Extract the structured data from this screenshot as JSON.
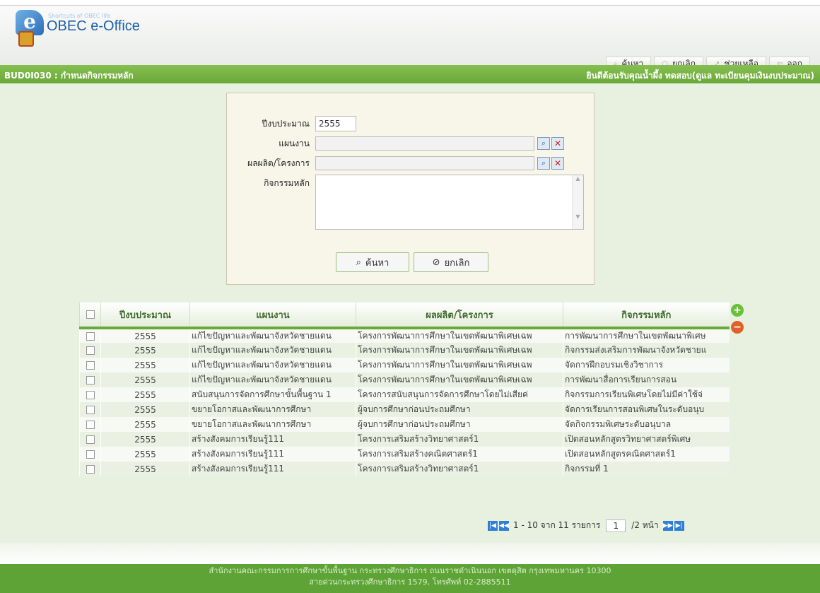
{
  "header": {
    "brand_tag": "Shortcuts of OBEC life",
    "brand_name": "OBEC e-Office",
    "nav": [
      {
        "label": "ค้นหา"
      },
      {
        "label": "ยกเลิก"
      },
      {
        "label": "ช่วยเหลือ"
      },
      {
        "label": "ออก"
      }
    ]
  },
  "title_bar": {
    "screen": "BUD0I030 : กำหนดกิจกรรมหลัก",
    "welcome": "ยินดีต้อนรับคุณน้ำผึ้ง ทดสอบ(ดูแล ทะเบียนคุมเงินงบประมาณ)"
  },
  "form": {
    "year_label": "ปีงบประมาณ",
    "year_value": "2555",
    "plan_label": "แผนงาน",
    "project_label": "ผลผลิต/โครงการ",
    "activity_label": "กิจกรรมหลัก",
    "search_button": "ค้นหา",
    "cancel_button": "ยกเลิก"
  },
  "table": {
    "columns": [
      "ปีงบประมาณ",
      "แผนงาน",
      "ผลผลิต/โครงการ",
      "กิจกรรมหลัก"
    ],
    "rows": [
      [
        "2555",
        "แก้ไขปัญหาและพัฒนาจังหวัดชายแดน",
        "โครงการพัฒนาการศึกษาในเขตพัฒนาพิเศษเฉพ",
        "การพัฒนาการศึกษาในเขตพัฒนาพิเศษ"
      ],
      [
        "2555",
        "แก้ไขปัญหาและพัฒนาจังหวัดชายแดน",
        "โครงการพัฒนาการศึกษาในเขตพัฒนาพิเศษเฉพ",
        "กิจกรรมส่งเสริมการพัฒนาจังหวัดชายแ"
      ],
      [
        "2555",
        "แก้ไขปัญหาและพัฒนาจังหวัดชายแดน",
        "โครงการพัฒนาการศึกษาในเขตพัฒนาพิเศษเฉพ",
        "จัดการฝึกอบรมเชิงวิชาการ"
      ],
      [
        "2555",
        "แก้ไขปัญหาและพัฒนาจังหวัดชายแดน",
        "โครงการพัฒนาการศึกษาในเขตพัฒนาพิเศษเฉพ",
        "การพัฒนาสื่อการเรียนการสอน"
      ],
      [
        "2555",
        "สนับสนุนการจัดการศึกษาขั้นพื้นฐาน 1",
        "โครงการสนับสนุนการจัดการศึกษาโดยไม่เสียค่",
        "กิจกรรมการเรียนพิเศษโดยไม่มีค่าใช้จ่"
      ],
      [
        "2555",
        "ขยายโอกาสและพัฒนาการศึกษา",
        "ผู้จบการศึกษาก่อนประถมศึกษา",
        "จัดการเรียนการสอนพิเศษในระดับอนุบ"
      ],
      [
        "2555",
        "ขยายโอกาสและพัฒนาการศึกษา",
        "ผู้จบการศึกษาก่อนประถมศึกษา",
        "จัดกิจกรรมพิเศษระดับอนุบาล"
      ],
      [
        "2555",
        "สร้างสังคมการเรียนรู้111",
        "โครงการเสริมสร้างวิทยาศาสตร์1",
        "เปิดสอนหลักสูตรวิทยาศาสตร์พิเศษ"
      ],
      [
        "2555",
        "สร้างสังคมการเรียนรู้111",
        "โครงการเสริมสร้างคณิตศาสตร์1",
        "เปิดสอนหลักสูตรคณิตศาสตร์1"
      ],
      [
        "2555",
        "สร้างสังคมการเรียนรู้111",
        "โครงการเสริมสร้างวิทยาศาสตร์1",
        "กิจกรรมที่ 1"
      ]
    ]
  },
  "pager": {
    "range_text": "1 - 10 จาก 11 รายการ",
    "page_value": "1",
    "total_text": "/2 หน้า"
  },
  "footer": {
    "line1": "สำนักงานคณะกรรมการการศึกษาขั้นพื้นฐาน กระทรวงศึกษาธิการ ถนนราชดำเนินนอก เขตดุสิต กรุงเทพมหานคร 10300",
    "line2": "สายด่วนกระทรวงศึกษาธิการ 1579, โทรศัพท์ 02-2885511"
  },
  "colors": {
    "accent_green": "#6aa83a",
    "footer_green": "#5ea335",
    "brand_blue": "#1c5fa8"
  },
  "icons": [
    "search-icon",
    "cancel-icon",
    "help-icon",
    "exit-icon",
    "lookup-icon",
    "clear-icon",
    "add-icon",
    "delete-icon",
    "first-page-icon",
    "prev-page-icon",
    "next-page-icon",
    "last-page-icon"
  ]
}
